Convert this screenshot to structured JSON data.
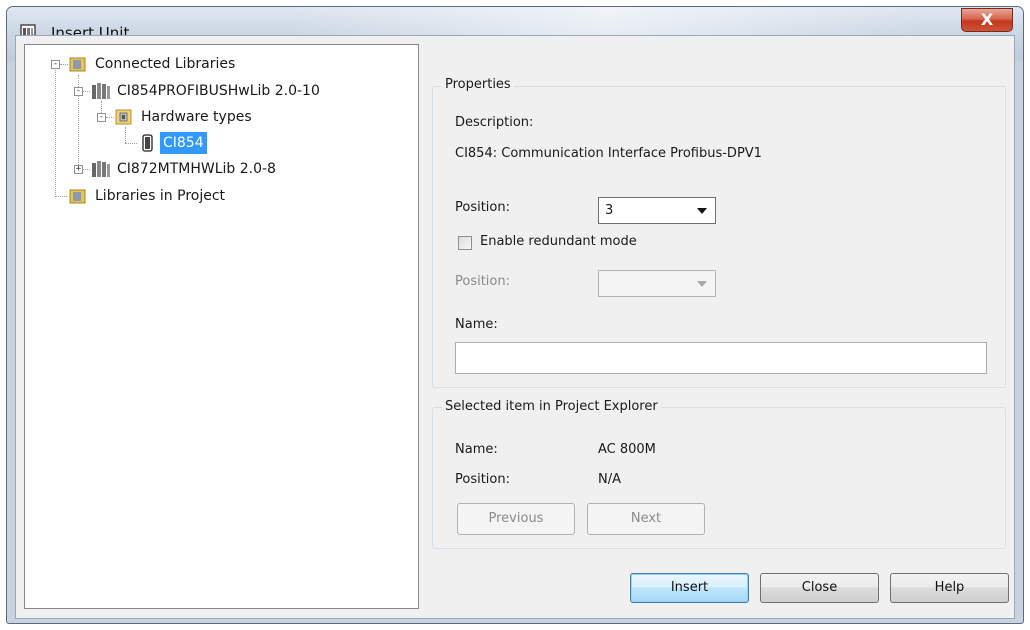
{
  "window": {
    "title": "Insert Unit",
    "close_glyph": "X"
  },
  "tree": {
    "items": [
      {
        "label": "Connected Libraries",
        "icon": "library-folder-icon",
        "expander": "-"
      },
      {
        "label": "CI854PROFIBUSHwLib 2.0-10",
        "icon": "hardware-library-icon",
        "expander": "-"
      },
      {
        "label": "Hardware types",
        "icon": "folder-icon",
        "expander": "-"
      },
      {
        "label": "CI854",
        "icon": "hardware-unit-icon",
        "selected": true
      },
      {
        "label": "CI872MTMHWLib 2.0-8",
        "icon": "hardware-library-icon",
        "expander": "+"
      },
      {
        "label": "Libraries in Project",
        "icon": "library-folder-icon"
      }
    ]
  },
  "properties": {
    "title": "Properties",
    "description_label": "Description:",
    "description_value": "CI854: Communication Interface Profibus-DPV1",
    "position_label": "Position:",
    "position_value": "3",
    "enable_redundant_label": "Enable redundant mode",
    "enable_redundant_checked": false,
    "redundant_position_label": "Position:",
    "redundant_position_value": "",
    "name_label": "Name:",
    "name_value": ""
  },
  "selected_item": {
    "title": "Selected item in Project Explorer",
    "name_label": "Name:",
    "name_value": "AC 800M",
    "position_label": "Position:",
    "position_value": "N/A",
    "previous_label": "Previous",
    "next_label": "Next"
  },
  "buttons": {
    "insert": "Insert",
    "close": "Close",
    "help": "Help"
  },
  "colors": {
    "selection": "#3399ff",
    "close_button": "#c7412a",
    "dialog_bg": "#f0f0f0"
  }
}
